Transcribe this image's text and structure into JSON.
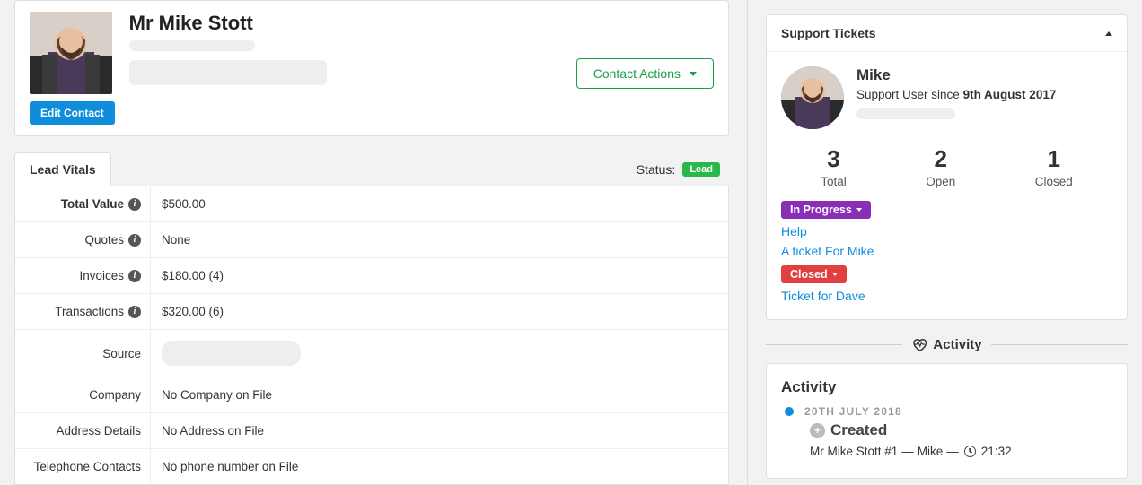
{
  "contact": {
    "name": "Mr Mike Stott",
    "edit_button": "Edit Contact",
    "actions_button": "Contact Actions"
  },
  "tabs": {
    "lead_vitals": "Lead Vitals",
    "status_label": "Status:",
    "status_badge": "Lead"
  },
  "vitals": {
    "total_value_label": "Total Value",
    "total_value": "$500.00",
    "quotes_label": "Quotes",
    "quotes": "None",
    "invoices_label": "Invoices",
    "invoices": "$180.00 (4)",
    "transactions_label": "Transactions",
    "transactions": "$320.00 (6)",
    "source_label": "Source",
    "company_label": "Company",
    "company": "No Company on File",
    "address_label": "Address Details",
    "address": "No Address on File",
    "phone_label": "Telephone Contacts",
    "phone": "No phone number on File"
  },
  "support": {
    "panel_title": "Support Tickets",
    "user_name": "Mike",
    "since_prefix": "Support User since ",
    "since_date": "9th August 2017",
    "stats": {
      "total_num": "3",
      "total_lbl": "Total",
      "open_num": "2",
      "open_lbl": "Open",
      "closed_num": "1",
      "closed_lbl": "Closed"
    },
    "in_progress_badge": "In Progress",
    "in_progress_tickets": [
      "Help",
      "A ticket For Mike"
    ],
    "closed_badge": "Closed",
    "closed_tickets": [
      "Ticket for Dave"
    ]
  },
  "activity": {
    "divider_label": "Activity",
    "panel_title": "Activity",
    "date": "20TH JULY 2018",
    "event": "Created",
    "meta_contact": "Mr Mike Stott #1",
    "meta_user": "Mike",
    "meta_time": "21:32"
  }
}
